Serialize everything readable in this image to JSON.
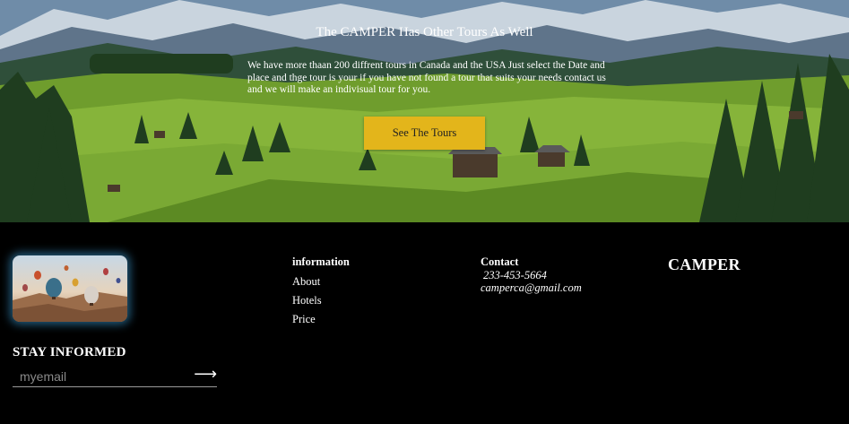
{
  "hero": {
    "title": "The CAMPER Has Other Tours As Well",
    "text": "We have more thaan 200 diffrent tours in Canada and the USA Just select the Date and place and thge tour is your if you have not found a tour that suits your needs contact us and we will make an indivisual tour for you.",
    "button_label": "See The Tours"
  },
  "newsletter": {
    "title": "STAY INFORMED",
    "placeholder": "myemail",
    "submit_icon": "arrow-right-icon"
  },
  "information": {
    "heading": "information",
    "links": [
      "About",
      "Hotels",
      "Price"
    ]
  },
  "contact": {
    "heading": "Contact",
    "phone": "233-453-5664",
    "email": "camperca@gmail.com"
  },
  "brand": {
    "name": "CAMPER"
  },
  "colors": {
    "button_bg": "#e3b51b",
    "footer_bg": "#000000",
    "thumb_glow": "#40aae6"
  }
}
